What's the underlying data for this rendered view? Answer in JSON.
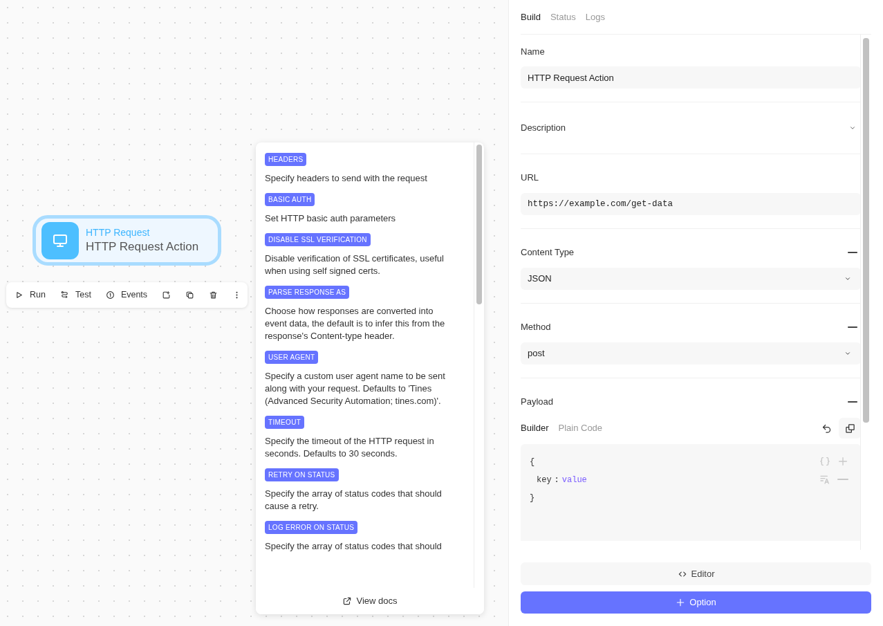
{
  "node": {
    "type": "HTTP Request",
    "name": "HTTP Request Action",
    "selected": true
  },
  "toolbar": [
    {
      "kind": "run",
      "label": "Run"
    },
    {
      "kind": "test",
      "label": "Test"
    },
    {
      "kind": "events",
      "label": "Events"
    },
    {
      "kind": "export"
    },
    {
      "kind": "duplicate"
    },
    {
      "kind": "delete"
    },
    {
      "kind": "more"
    }
  ],
  "docs": {
    "items": [
      {
        "tag": "HEADERS",
        "text": "Specify headers to send with the request"
      },
      {
        "tag": "BASIC AUTH",
        "text": "Set HTTP basic auth parameters"
      },
      {
        "tag": "DISABLE SSL VERIFICATION",
        "text": "Disable verification of SSL certificates, useful when using self signed certs."
      },
      {
        "tag": "PARSE RESPONSE AS",
        "text": "Choose how responses are converted into event data, the default is to infer this from the response's Content-type header."
      },
      {
        "tag": "USER AGENT",
        "text": "Specify a custom user agent name to be sent along with your request. Defaults to 'Tines (Advanced Security Automation; tines.com)'."
      },
      {
        "tag": "TIMEOUT",
        "text": "Specify the timeout of the HTTP request in seconds. Defaults to 30 seconds."
      },
      {
        "tag": "RETRY ON STATUS",
        "text": "Specify the array of status codes that should cause a retry."
      },
      {
        "tag": "LOG ERROR ON STATUS",
        "text": "Specify the array of status codes that should"
      }
    ],
    "footer": "View docs"
  },
  "tabs": [
    {
      "label": "Build",
      "selected": true
    },
    {
      "label": "Status",
      "selected": false
    },
    {
      "label": "Logs",
      "selected": false
    }
  ],
  "sections": [
    {
      "kind": "text",
      "label": "Name",
      "value": "HTTP Request Action"
    },
    {
      "kind": "collapsible",
      "label": "Description",
      "expanded": false
    },
    {
      "kind": "code",
      "label": "URL",
      "value": "https://example.com/get-data"
    },
    {
      "kind": "select",
      "label": "Content Type",
      "expanded": true,
      "value": "JSON"
    },
    {
      "kind": "select",
      "label": "Method",
      "expanded": true,
      "value": "post"
    },
    {
      "kind": "payload",
      "label": "Payload",
      "expanded": true,
      "tabs": [
        {
          "label": "Builder",
          "selected": true
        },
        {
          "label": "Plain Code",
          "selected": false
        }
      ],
      "open": "{",
      "key": "key",
      "separator": ":",
      "value": "value",
      "close": "}"
    }
  ],
  "editor_button": "Editor",
  "option_button": "Option"
}
